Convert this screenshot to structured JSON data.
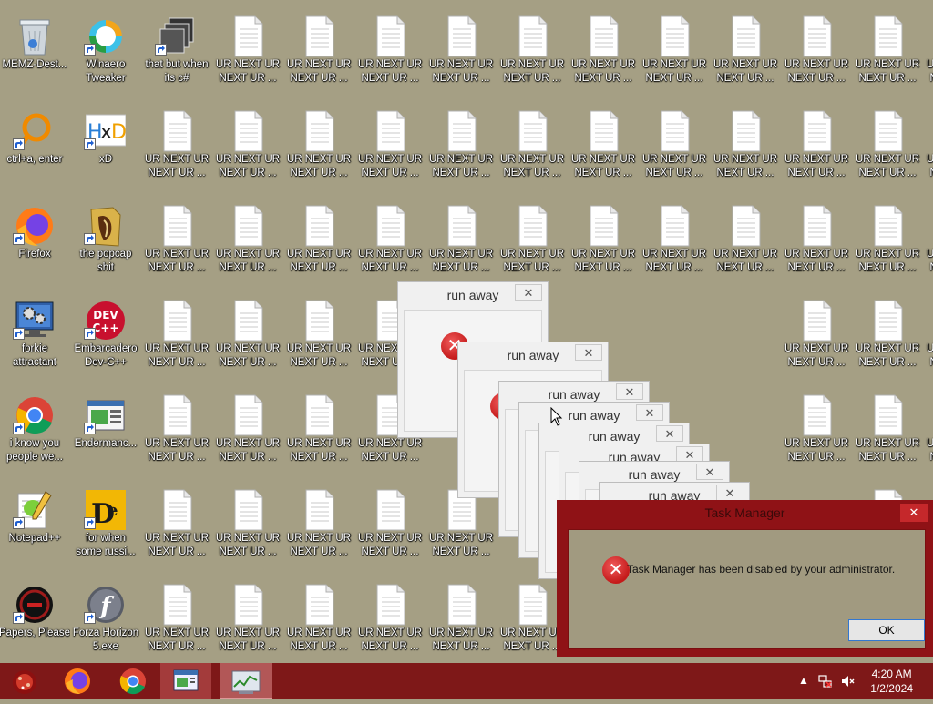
{
  "desktop": {
    "app_icons": [
      {
        "label": "MEMZ-Dest...",
        "icon": "recycle-bin-icon",
        "col": 0,
        "row": 0
      },
      {
        "label": "Winaero\nTweaker",
        "icon": "winaero-tweaker-icon",
        "col": 1,
        "row": 0
      },
      {
        "label": "that but when\nits c#",
        "icon": "stacked-windows-icon",
        "col": 2,
        "row": 0
      },
      {
        "label": "ctrl+a, enter",
        "icon": "magnifier-icon",
        "col": 0,
        "row": 1
      },
      {
        "label": "xD",
        "icon": "hxd-icon",
        "col": 1,
        "row": 1
      },
      {
        "label": "Firefox",
        "icon": "firefox-icon",
        "col": 0,
        "row": 2
      },
      {
        "label": "the popcap\nshit",
        "icon": "folder-icon",
        "col": 1,
        "row": 2
      },
      {
        "label": "forkie\nattractant",
        "icon": "monitor-gear-icon",
        "col": 0,
        "row": 3
      },
      {
        "label": "Embarcadero\nDev-C++",
        "icon": "devcpp-icon",
        "col": 1,
        "row": 3
      },
      {
        "label": "i know you\npeople we...",
        "icon": "chrome-icon",
        "col": 0,
        "row": 4
      },
      {
        "label": "Endermanc...",
        "icon": "app-window-icon",
        "col": 1,
        "row": 4
      },
      {
        "label": "Notepad++",
        "icon": "notepadpp-icon",
        "col": 0,
        "row": 5
      },
      {
        "label": "for when\nsome russi...",
        "icon": "de-icon",
        "col": 1,
        "row": 5
      },
      {
        "label": "Papers, Please",
        "icon": "papers-please-icon",
        "col": 0,
        "row": 6
      },
      {
        "label": "Forza Horizon\n5.exe",
        "icon": "flash-icon",
        "col": 1,
        "row": 6
      }
    ],
    "file_label": "UR NEXT UR\nNEXT UR ..."
  },
  "runaway_dialogs": {
    "title": "run away",
    "close_glyph": "✕",
    "error_glyph": "✕",
    "count": 8
  },
  "task_manager": {
    "title": "Task Manager",
    "message": "Task Manager has been disabled by your administrator.",
    "ok_label": "OK",
    "close_glyph": "✕",
    "error_glyph": "✕"
  },
  "taskbar": {
    "items": [
      "start-orb-icon",
      "firefox-icon",
      "chrome-icon",
      "app-window-icon",
      "task-manager-icon"
    ],
    "tray_arrow": "▲",
    "clock_time": "4:20 AM",
    "clock_date": "1/2/2024"
  },
  "colors": {
    "desktop_bg": "#a59f84",
    "taskbar_bg": "#7e1818",
    "dialog_frame": "#8f1216"
  }
}
